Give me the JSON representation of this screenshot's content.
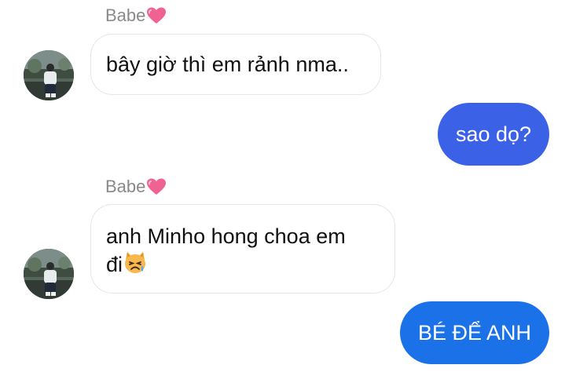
{
  "messages": [
    {
      "direction": "incoming",
      "sender": "Babe",
      "text": "bây giờ thì em rảnh nma.."
    },
    {
      "direction": "outgoing",
      "text": "sao dọ?"
    },
    {
      "direction": "incoming",
      "sender": "Babe",
      "text_line1": "anh Minho hong choa em",
      "text_line2": "đi",
      "emoji": "crying-cat-emoji"
    },
    {
      "direction": "outgoing",
      "text": "BÉ ĐỂ ANH"
    }
  ],
  "icons": {
    "sender_suffix": "pink-heart-emoji",
    "avatar": "contact-avatar"
  },
  "colors": {
    "background": "#ffffff",
    "incoming_bubble": "#ffffff",
    "incoming_border": "#e6e6e6",
    "outgoing_bubble_top": "#3d5fe8",
    "outgoing_bubble_bottom": "#1a73e8",
    "sender_name": "#8a8a8a",
    "heart": "#f06292"
  }
}
